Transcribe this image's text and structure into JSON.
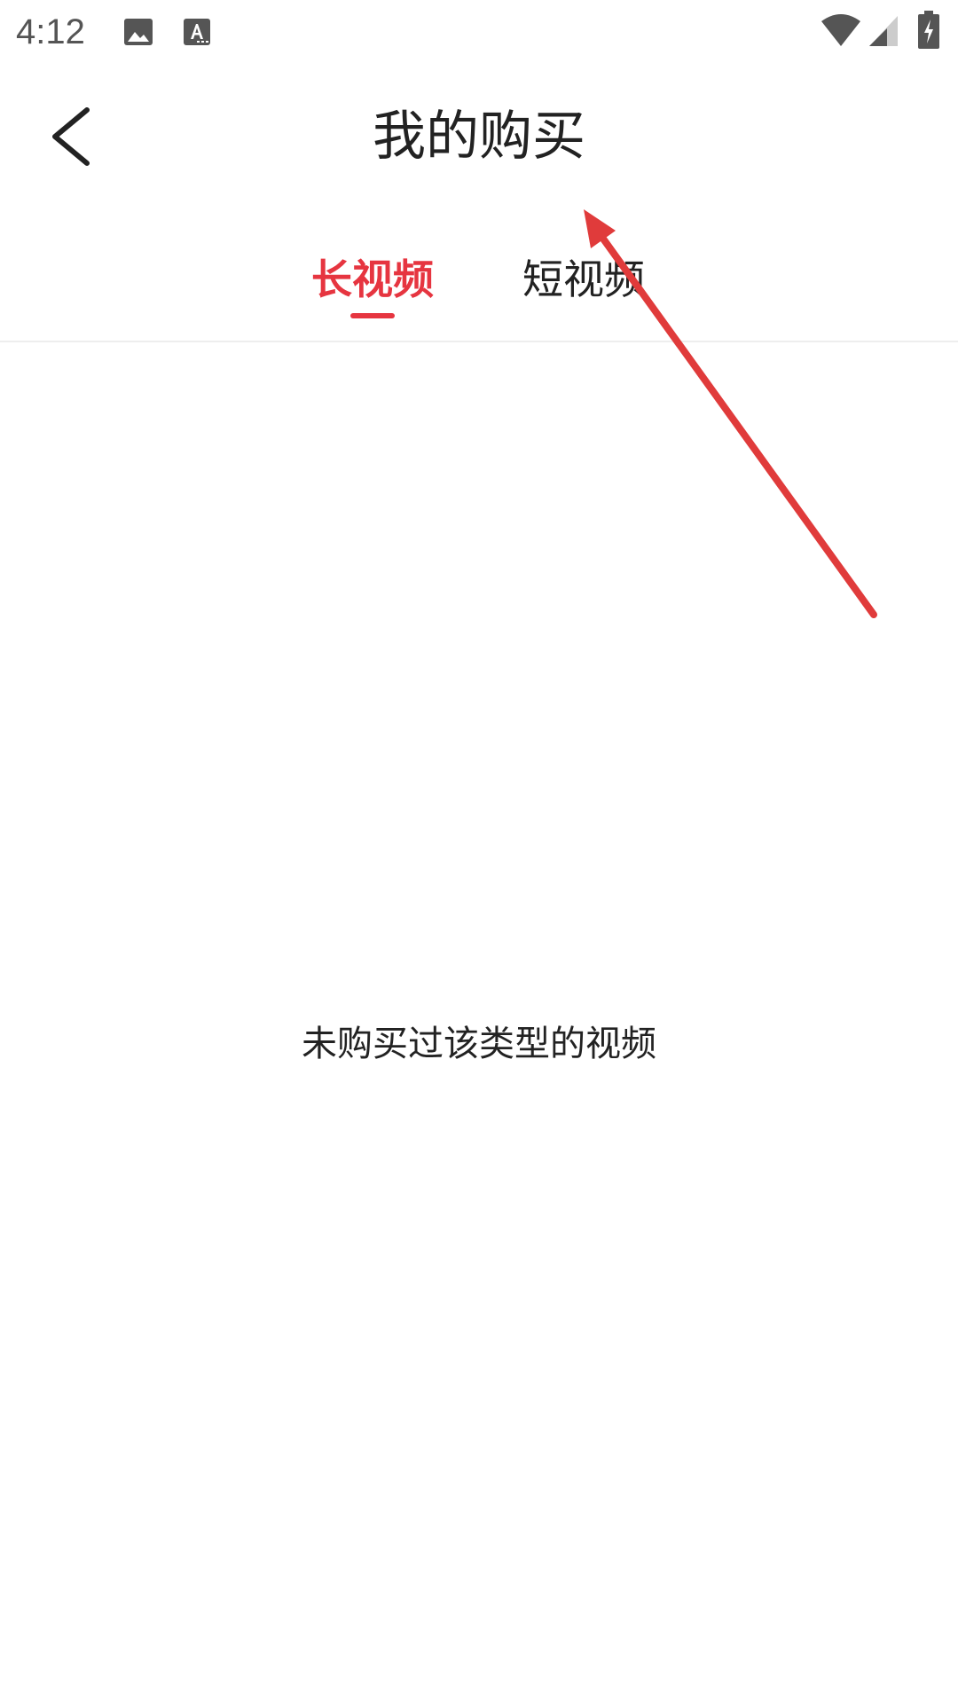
{
  "status_bar": {
    "time": "4:12",
    "icons": [
      "image-icon",
      "text-a-icon",
      "wifi-icon",
      "cell-signal-icon",
      "battery-charging-icon"
    ]
  },
  "header": {
    "title": "我的购买",
    "back_icon": "chevron-left-icon"
  },
  "tabs": [
    {
      "label": "长视频",
      "selected": true
    },
    {
      "label": "短视频",
      "selected": false
    }
  ],
  "empty_state": {
    "message": "未购买过该类型的视频"
  },
  "colors": {
    "accent": "#e63540",
    "text": "#222222",
    "status_gray": "#555555",
    "divider": "#eeeeee",
    "annotation": "#e03b3b"
  }
}
